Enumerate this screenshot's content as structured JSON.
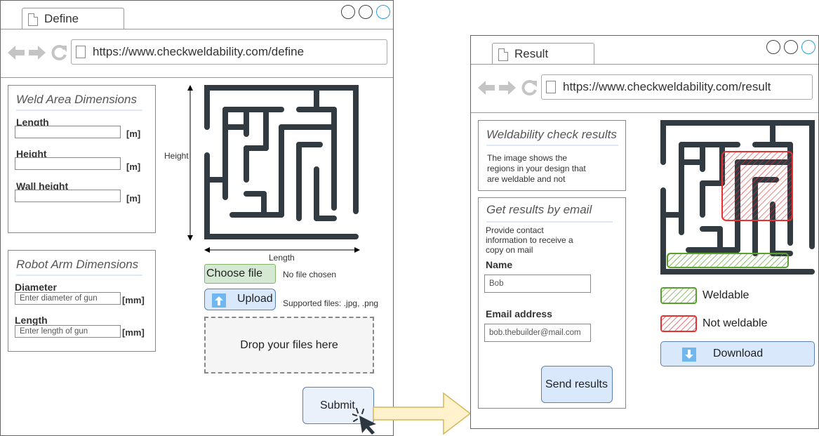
{
  "define_window": {
    "tab_title": "Define",
    "url": "https://www.checkweldability.com/define",
    "weld_area": {
      "title": "Weld Area Dimensions",
      "fields": [
        {
          "label": "Length",
          "value": "",
          "unit": "[m]"
        },
        {
          "label": "Height",
          "value": "",
          "unit": "[m]"
        },
        {
          "label": "Wall height",
          "value": "",
          "unit": "[m]"
        }
      ]
    },
    "robot_arm": {
      "title": "Robot Arm Dimensions",
      "fields": [
        {
          "label": "Diameter",
          "placeholder": "Enter diameter of gun",
          "unit": "[mm]"
        },
        {
          "label": "Length",
          "placeholder": "Enter length of gun",
          "unit": "[mm]"
        }
      ]
    },
    "dimension_height_label": "Height",
    "dimension_length_label": "Length",
    "choose_file_label": "Choose file",
    "no_file_text": "No file chosen",
    "upload_label": "Upload",
    "supported_files_text": "Supported files: .jpg, .png",
    "dropzone_text": "Drop your files here",
    "submit_label": "Submit"
  },
  "result_window": {
    "tab_title": "Result",
    "url": "https://www.checkweldability.com/result",
    "results_panel": {
      "title": "Weldability check results",
      "text_lines": [
        "The image shows the",
        "regions in your design that",
        "are weldable and not"
      ]
    },
    "email_panel": {
      "title": "Get results by email",
      "text_lines": [
        "Provide contact",
        "information to receive a",
        "copy on mail"
      ],
      "name_label": "Name",
      "name_value": "Bob",
      "email_label": "Email address",
      "email_value": "bob.thebuilder@mail.com",
      "send_label": "Send results"
    },
    "legend": [
      {
        "label": "Weldable",
        "color": "#5aa02c"
      },
      {
        "label": "Not weldable",
        "color": "#e83030"
      }
    ],
    "download_label": "Download"
  },
  "colors": {
    "maze": "#333b42",
    "accent_blue": "#dae8fc",
    "arrow_fill": "#fff2cc",
    "arrow_stroke": "#d6b656"
  }
}
